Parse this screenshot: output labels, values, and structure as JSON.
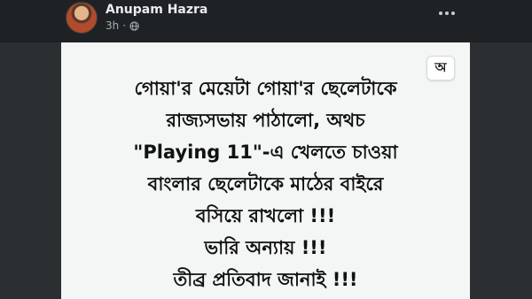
{
  "post": {
    "author": "Anupam Hazra",
    "time": "3h",
    "privacy_icon": "globe-icon",
    "more_icon": "more-options-icon"
  },
  "image": {
    "translate_label": "অ",
    "lines": [
      "গোয়া'র মেয়েটা গোয়া'র ছেলেটাকে",
      "রাজ্যসভায় পাঠালো, অথচ",
      "\"Playing 11\"-এ খেলতে চাওয়া",
      "বাংলার ছেলেটাকে মাঠের বাইরে",
      "বসিয়ে রাখলো !!!",
      "ভারি অন্যায় !!!",
      "তীব্র প্রতিবাদ জানাই !!!"
    ]
  }
}
